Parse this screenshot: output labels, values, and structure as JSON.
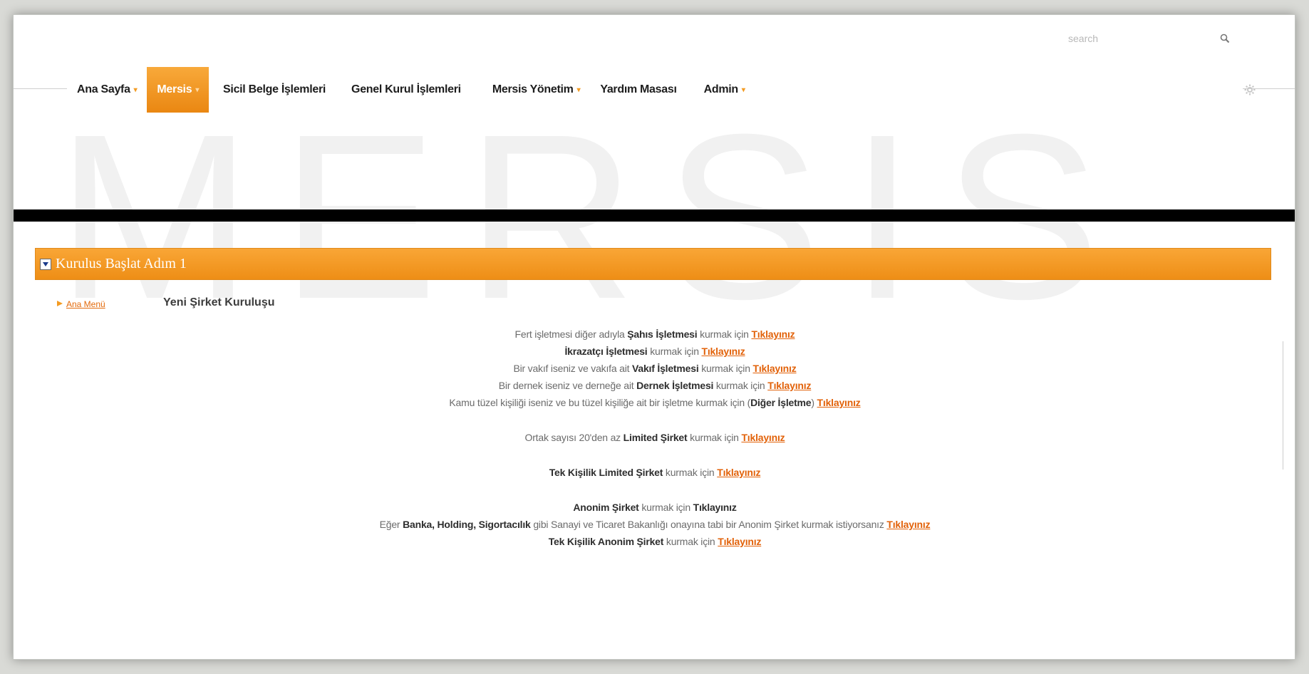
{
  "app": {
    "watermark": "MERSIS"
  },
  "search": {
    "placeholder": "search",
    "icon": "search-icon"
  },
  "nav": {
    "items": [
      {
        "label": "Ana Sayfa",
        "caret": true,
        "active": false
      },
      {
        "label": "Mersis",
        "caret": true,
        "active": true
      },
      {
        "label": "Sicil Belge İşlemleri",
        "caret": false,
        "active": false
      },
      {
        "label": "Genel Kurul İşlemleri",
        "caret": false,
        "active": false
      },
      {
        "label": "Mersis Yönetim",
        "caret": true,
        "active": false
      },
      {
        "label": "Yardım Masası",
        "caret": false,
        "active": false
      },
      {
        "label": "Admin",
        "caret": true,
        "active": false
      }
    ],
    "settings_icon": "gear-icon"
  },
  "panel": {
    "title": "Kurulus Başlat Adım 1"
  },
  "ana_menu": {
    "label": "Ana Menü"
  },
  "section": {
    "title": "Yeni Şirket Kuruluşu"
  },
  "lines": {
    "l1": {
      "pre": "Fert işletmesi diğer adıyla ",
      "strong": "Şahıs İşletmesi",
      "post": " kurmak için ",
      "link": "Tıklayınız"
    },
    "l2": {
      "pre": "",
      "strong": "İkrazatçı İşletmesi",
      "post": " kurmak için ",
      "link": "Tıklayınız"
    },
    "l3": {
      "pre": "Bir vakıf iseniz ve vakıfa ait ",
      "strong": "Vakıf İşletmesi",
      "post": " kurmak için ",
      "link": "Tıklayınız"
    },
    "l4": {
      "pre": "Bir dernek iseniz ve derneğe ait ",
      "strong": "Dernek İşletmesi",
      "post": " kurmak için ",
      "link": "Tıklayınız"
    },
    "l5": {
      "pre": "Kamu tüzel kişiliği iseniz ve bu tüzel kişiliğe ait bir işletme kurmak için (",
      "strong": "Diğer İşletme",
      "post": ") ",
      "link": "Tıklayınız"
    },
    "l6": {
      "pre": "Ortak sayısı 20'den az ",
      "strong": "Limited Şirket",
      "post": " kurmak için ",
      "link": "Tıklayınız"
    },
    "l7": {
      "pre": "",
      "strong": "Tek Kişilik Limited Şirket",
      "post": " kurmak için ",
      "link": "Tıklayınız"
    },
    "l8": {
      "pre": "",
      "strong": "Anonim Şirket",
      "post": " kurmak için ",
      "link": "Tıklayınız"
    },
    "l9": {
      "pre": "Eğer ",
      "strong": "Banka, Holding, Sigortacılık",
      "post": " gibi Sanayi ve Ticaret Bakanlığı onayına tabi bir Anonim Şirket kurmak istiyorsanız ",
      "link": "Tıklayınız"
    },
    "l10": {
      "pre": "",
      "strong": "Tek Kişilik Anonim Şirket",
      "post": " kurmak için ",
      "link": "Tıklayınız"
    }
  },
  "colors": {
    "accent": "#f39b22",
    "link": "#e2620a",
    "bar": "#000000"
  }
}
